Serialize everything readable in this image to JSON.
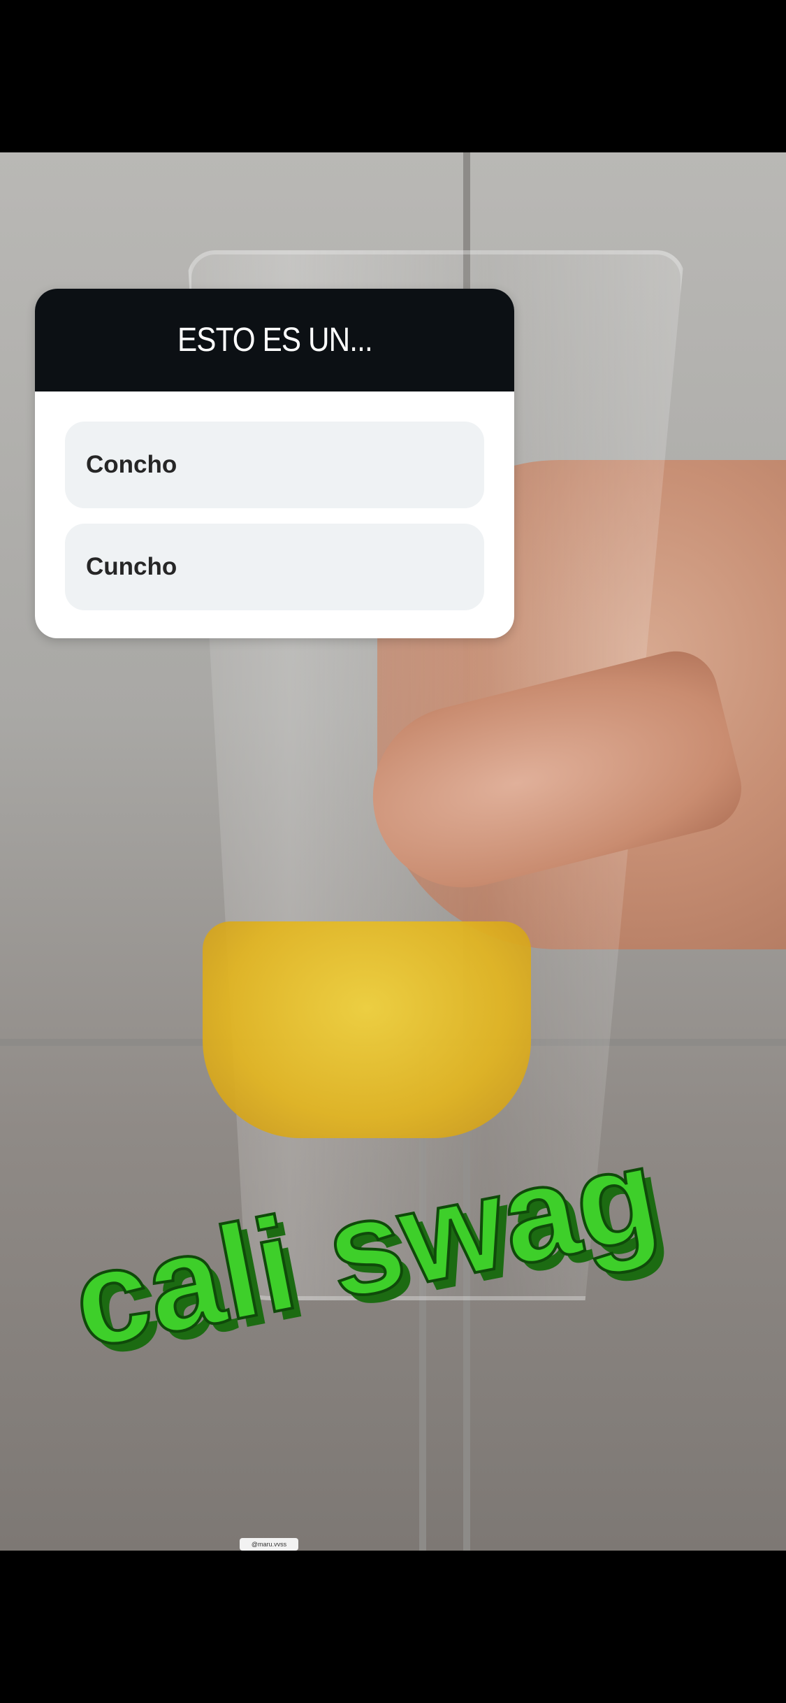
{
  "poll": {
    "question": "ESTO ES UN...",
    "options": [
      {
        "label": "Concho"
      },
      {
        "label": "Cuncho"
      }
    ]
  },
  "sticker": {
    "text": "cali swag",
    "color": "#3ecf2a"
  },
  "credit": {
    "username": "@maru.vvss"
  },
  "colors": {
    "poll_header_bg": "#0c1014",
    "option_bg": "#eff2f4"
  }
}
